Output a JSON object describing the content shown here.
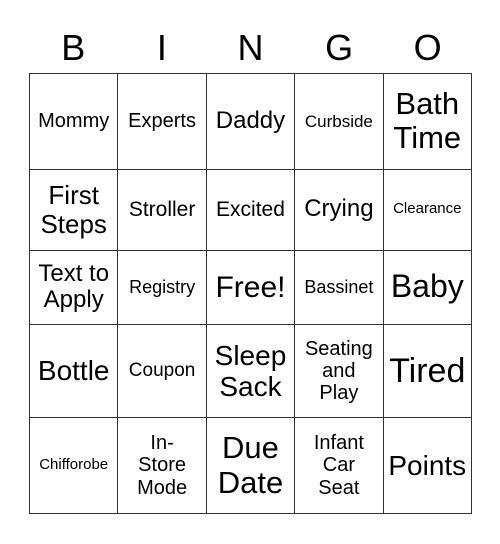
{
  "header": [
    "B",
    "I",
    "N",
    "G",
    "O"
  ],
  "grid": [
    [
      "Mommy",
      "Experts",
      "Daddy",
      "Curbside",
      "Bath\nTime"
    ],
    [
      "First\nSteps",
      "Stroller",
      "Excited",
      "Crying",
      "Clearance"
    ],
    [
      "Text to\nApply",
      "Registry",
      "Free!",
      "Bassinet",
      "Baby"
    ],
    [
      "Bottle",
      "Coupon",
      "Sleep\nSack",
      "Seating\nand\nPlay",
      "Tired"
    ],
    [
      "Chifforobe",
      "In-\nStore\nMode",
      "Due\nDate",
      "Infant\nCar\nSeat",
      "Points"
    ]
  ]
}
